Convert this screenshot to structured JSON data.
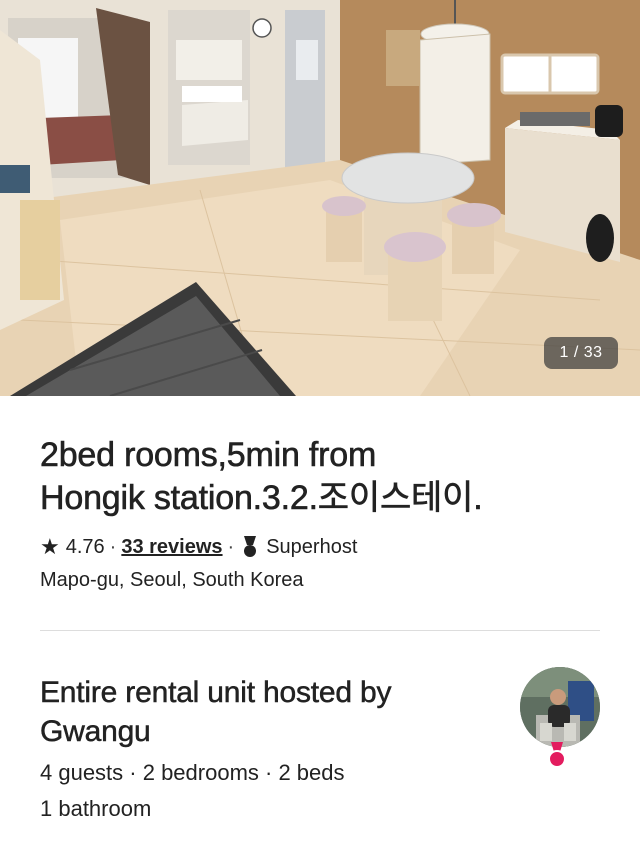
{
  "photo": {
    "counter": "1 / 33",
    "alt": "Apartment living area with round table and stools"
  },
  "listing": {
    "title_line1": "2bed rooms,5min from",
    "title_line2": "Hongik station.3.2.조이스테이.",
    "rating": "4.76",
    "separator": "·",
    "reviews": "33 reviews",
    "superhost": "Superhost",
    "location": "Mapo-gu, Seoul, South Korea"
  },
  "host": {
    "title_line1": "Entire rental unit hosted by",
    "title_line2": "Gwangu",
    "details_line1": "4 guests · 2 bedrooms · 2 beds",
    "details_line2": "1 bathroom"
  },
  "colors": {
    "text": "#222222",
    "brand": "#ff385c",
    "divider": "#dddddd"
  },
  "icons": [
    "star-icon",
    "superhost-medal-icon",
    "superhost-badge-icon"
  ]
}
